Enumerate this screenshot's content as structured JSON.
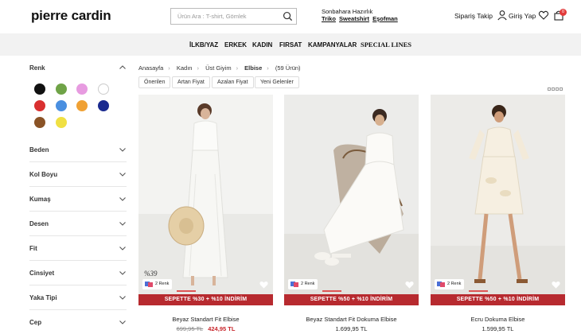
{
  "header": {
    "logo": "pierre cardin",
    "search_placeholder": "Ürün Ara : T-shirt, Gömlek",
    "promo_title": "Sonbahara Hazırlık",
    "promo_links": [
      "Triko",
      "Sweatshirt",
      "Eşofman"
    ],
    "order_track": "Sipariş Takip",
    "login": "Giriş Yap",
    "cart_count": "0"
  },
  "nav": [
    "İLKB/YAZ",
    "ERKEK",
    "KADIN",
    "FIRSAT",
    "KAMPANYALAR",
    "SPECIAL LINES"
  ],
  "sidebar": {
    "color_title": "Renk",
    "swatches": [
      "#111111",
      "#6fa347",
      "#e79be0",
      "#ffffff",
      "#d93030",
      "#4a8fe0",
      "#f0a134",
      "#1a2a8f",
      "#8a5326",
      "#f0e043"
    ],
    "filters": [
      "Beden",
      "Kol Boyu",
      "Kumaş",
      "Desen",
      "Fit",
      "Cinsiyet",
      "Yaka Tipi",
      "Cep"
    ]
  },
  "breadcrumb": {
    "items": [
      "Anasayfa",
      "Kadın",
      "Üst Giyim",
      "Elbise"
    ],
    "count": "(59 Ürün)"
  },
  "sort": [
    "Önerilen",
    "Artan Fiyat",
    "Azalan Fiyat",
    "Yeni Gelenler"
  ],
  "products": [
    {
      "name": "Beyaz Standart Fit Elbise",
      "old_price": "699,95 TL",
      "price": "424,95 TL",
      "campaign": "SEPETTE %30 + %10 İNDİRİM",
      "colors": "2 Renk",
      "tag": "%39"
    },
    {
      "name": "Beyaz Standart Fit Dokuma Elbise",
      "price": "1.699,95 TL",
      "campaign": "SEPETTE %50 + %10 İNDİRİM",
      "colors": "2 Renk"
    },
    {
      "name": "Ecru Dokuma Elbise",
      "price": "1.599,95 TL",
      "campaign": "SEPETTE %50 + %10 İNDİRİM",
      "colors": "2 Renk"
    }
  ]
}
